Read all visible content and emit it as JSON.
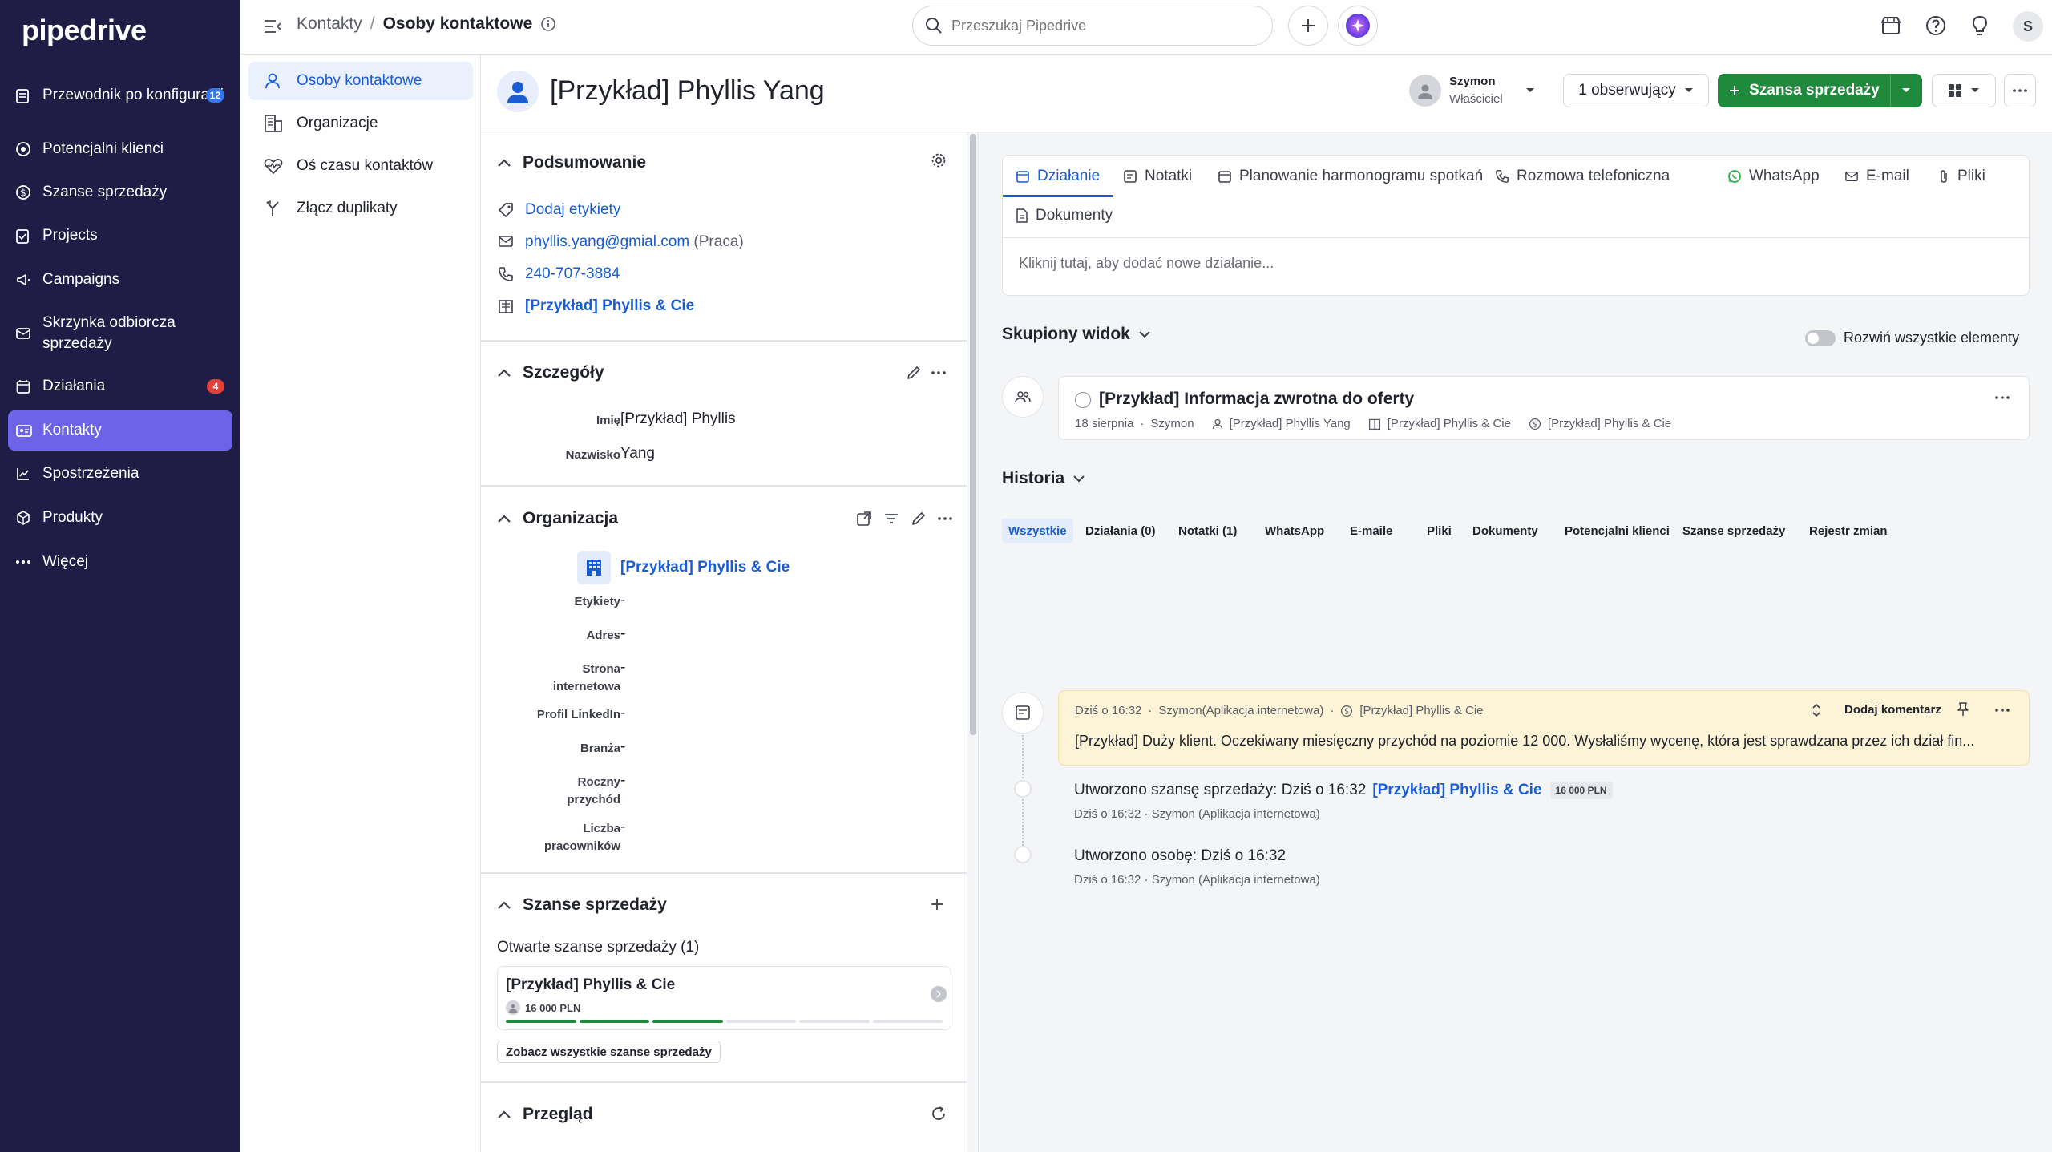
{
  "nav": {
    "logo": "pipedrive",
    "items": [
      {
        "label": "Przewodnik po konfiguracji",
        "icon": "clipboard-icon",
        "badge": "12"
      },
      {
        "label": "Potencjalni klienci",
        "icon": "target-icon"
      },
      {
        "label": "Szanse sprzedaży",
        "icon": "dollar-icon"
      },
      {
        "label": "Projects",
        "icon": "clipboard-check-icon"
      },
      {
        "label": "Campaigns",
        "icon": "megaphone-icon"
      },
      {
        "label": "Skrzynka odbiorcza sprzedaży",
        "icon": "mail-icon"
      },
      {
        "label": "Działania",
        "icon": "calendar-icon",
        "badge": "4"
      },
      {
        "label": "Kontakty",
        "icon": "contact-card-icon",
        "active": true
      },
      {
        "label": "Spostrzeżenia",
        "icon": "chart-icon"
      },
      {
        "label": "Produkty",
        "icon": "box-icon"
      },
      {
        "label": "Więcej",
        "icon": "more-icon"
      }
    ]
  },
  "topbar": {
    "crumb_root": "Kontakty",
    "crumb_sep": "/",
    "crumb_current": "Osoby kontaktowe",
    "search_placeholder": "Przeszukaj Pipedrive",
    "user_initial": "S"
  },
  "subnav": {
    "items": [
      {
        "label": "Osoby kontaktowe",
        "active": true
      },
      {
        "label": "Organizacje"
      },
      {
        "label": "Oś czasu kontaktów"
      },
      {
        "label": "Złącz duplikaty"
      }
    ]
  },
  "person": {
    "name": "[Przykład] Phyllis Yang",
    "owner_name": "Szymon",
    "owner_role": "Właściciel",
    "followers_label": "1 obserwujący",
    "deal_button": "Szansa sprzedaży"
  },
  "summary": {
    "title": "Podsumowanie",
    "add_labels": "Dodaj etykiety",
    "email": "phyllis.yang@gmial.com",
    "email_type": "(Praca)",
    "phone": "240-707-3884",
    "org": "[Przykład] Phyllis & Cie"
  },
  "details": {
    "title": "Szczegóły",
    "fields": [
      {
        "label": "Imię",
        "value": "[Przykład] Phyllis"
      },
      {
        "label": "Nazwisko",
        "value": "Yang"
      }
    ]
  },
  "organization": {
    "title": "Organizacja",
    "name": "[Przykład] Phyllis & Cie",
    "fields": [
      {
        "label": "Etykiety",
        "value": "-"
      },
      {
        "label": "Adres",
        "value": "-"
      },
      {
        "label": "Strona internetowa",
        "value": "-"
      },
      {
        "label": "Profil LinkedIn",
        "value": "-"
      },
      {
        "label": "Branża",
        "value": "-"
      },
      {
        "label": "Roczny przychód",
        "value": "-"
      },
      {
        "label": "Liczba pracowników",
        "value": "-"
      }
    ]
  },
  "deals": {
    "title": "Szanse sprzedaży",
    "open_label": "Otwarte szanse sprzedaży (1)",
    "deal_name": "[Przykład] Phyllis & Cie",
    "deal_value": "16 000 PLN",
    "stages_done": 3,
    "stages_total": 6,
    "see_all": "Zobacz wszystkie szanse sprzedaży"
  },
  "overview": {
    "title": "Przegląd"
  },
  "composer": {
    "tabs": [
      {
        "label": "Działanie",
        "icon": "calendar-icon",
        "active": true
      },
      {
        "label": "Notatki",
        "icon": "note-icon"
      },
      {
        "label": "Planowanie harmonogramu spotkań",
        "icon": "calendar-icon"
      },
      {
        "label": "Rozmowa telefoniczna",
        "icon": "phone-icon"
      },
      {
        "label": "WhatsApp",
        "icon": "whatsapp-icon"
      },
      {
        "label": "E-mail",
        "icon": "mail-icon"
      },
      {
        "label": "Pliki",
        "icon": "paperclip-icon"
      },
      {
        "label": "Dokumenty",
        "icon": "document-icon"
      }
    ],
    "placeholder": "Kliknij tutaj, aby dodać nowe działanie..."
  },
  "focus": {
    "title": "Skupiony widok",
    "expand_label": "Rozwiń wszystkie elementy",
    "activity_title": "[Przykład] Informacja zwrotna do oferty",
    "activity_date": "18 sierpnia",
    "activity_sep": "·",
    "activity_owner": "Szymon",
    "activity_person": "[Przykład] Phyllis Yang",
    "activity_org": "[Przykład] Phyllis & Cie",
    "activity_deal": "[Przykład] Phyllis & Cie"
  },
  "history": {
    "title": "Historia",
    "tabs": [
      "Wszystkie",
      "Działania (0)",
      "Notatki (1)",
      "WhatsApp",
      "E-maile",
      "Pliki",
      "Dokumenty",
      "Potencjalni klienci",
      "Szanse sprzedaży",
      "Rejestr zmian"
    ],
    "note": {
      "time": "Dziś o 16:32",
      "sep": "·",
      "author": "Szymon(Aplikacja internetowa)",
      "deal": "[Przykład] Phyllis & Cie",
      "add_comment": "Dodaj komentarz",
      "text": "[Przykład] Duży klient. Oczekiwany miesięczny przychód na poziomie 12 000. Wysłaliśmy wycenę, która jest sprawdzana przez ich dział fin..."
    },
    "events": [
      {
        "title": "Utworzono szansę sprzedaży",
        "when": ": Dziś o 16:32",
        "link": "[Przykład] Phyllis & Cie",
        "value": "16 000 PLN",
        "meta": "Dziś o 16:32 · Szymon (Aplikacja internetowa)"
      },
      {
        "title": "Utworzono osobę",
        "when": ": Dziś o 16:32",
        "meta": "Dziś o 16:32 · Szymon (Aplikacja internetowa)"
      }
    ]
  },
  "colors": {
    "nav_bg": "#1f1d45",
    "nav_active": "#6c63e8",
    "link": "#1a5cd1",
    "primary_green": "#1f8a3b",
    "note_bg": "#fdf4d7"
  }
}
